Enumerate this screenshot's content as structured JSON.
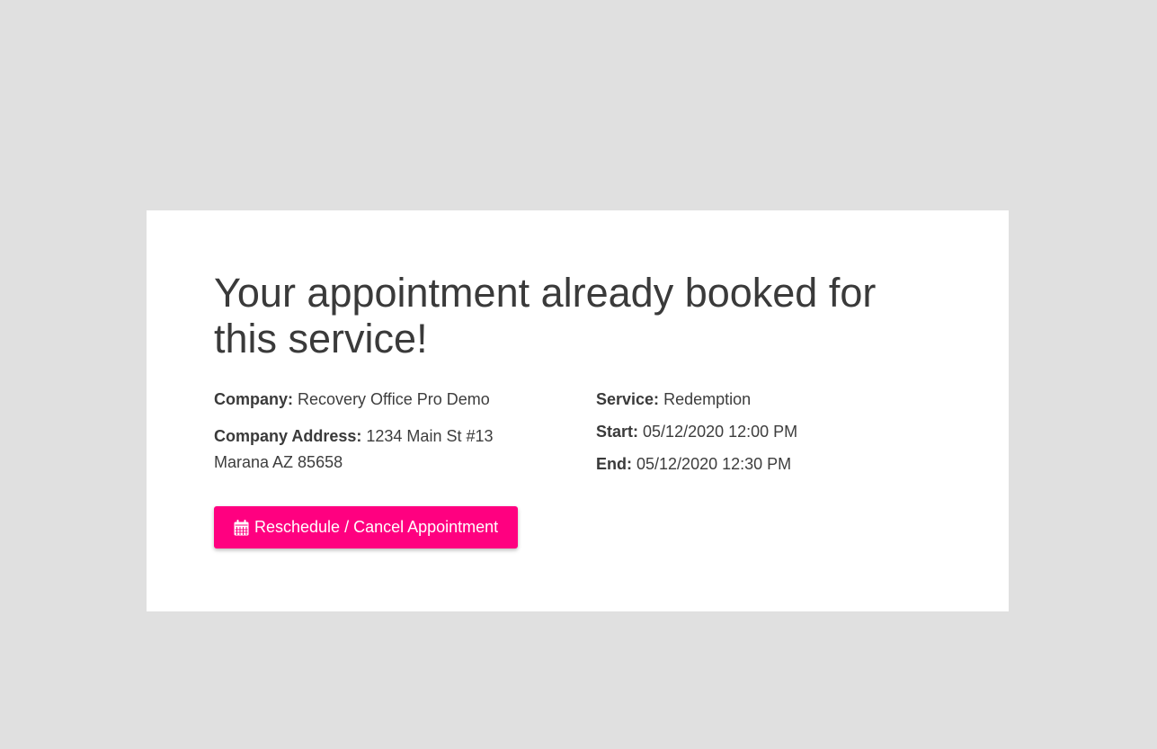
{
  "heading": "Your appointment already booked for this service!",
  "company": {
    "label": "Company:",
    "value": "Recovery Office Pro Demo"
  },
  "company_address": {
    "label": "Company Address:",
    "line1": "1234 Main St #13",
    "line2": "Marana AZ 85658"
  },
  "service": {
    "label": "Service:",
    "value": "Redemption"
  },
  "start": {
    "label": "Start:",
    "value": "05/12/2020 12:00 PM"
  },
  "end": {
    "label": "End:",
    "value": "05/12/2020 12:30 PM"
  },
  "button": {
    "label": "Reschedule / Cancel Appointment",
    "icon": "calendar-icon",
    "color": "#ff0080"
  },
  "colors": {
    "background": "#e0e0e0",
    "card": "#ffffff",
    "text": "#3d3d3d"
  }
}
